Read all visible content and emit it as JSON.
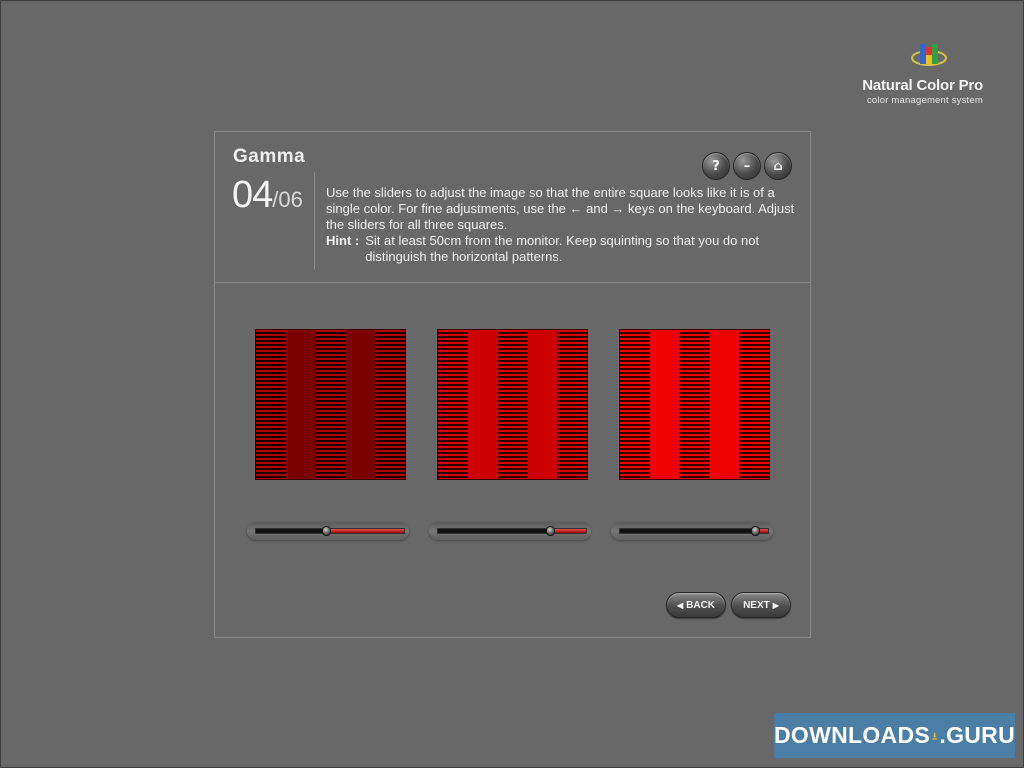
{
  "brand": {
    "name": "Natural Color Pro",
    "tagline": "color management system"
  },
  "header": {
    "title": "Gamma",
    "step_current": "04",
    "step_total": "/06",
    "description": "Use the sliders to adjust the image so that the entire square looks like it is of a single color.  For fine adjustments, use the ← and → keys on the keyboard.  Adjust the sliders for all three squares.",
    "hint_label": "Hint :",
    "hint_text": "Sit at least 50cm from the monitor.  Keep squinting so that you do not distinguish the horizontal patterns."
  },
  "toolbar": {
    "help_glyph": "?",
    "minimize_glyph": "–",
    "home_glyph": "⌂"
  },
  "squares": [
    {
      "stripe_color": "#7a0000",
      "line_color": "#b00000",
      "dark_color": "#1a0000"
    },
    {
      "stripe_color": "#cc0000",
      "line_color": "#d80000",
      "dark_color": "#2a0000"
    },
    {
      "stripe_color": "#ee0000",
      "line_color": "#f20000",
      "dark_color": "#330000"
    }
  ],
  "sliders": [
    {
      "value": 0.47
    },
    {
      "value": 0.76
    },
    {
      "value": 0.91
    }
  ],
  "nav": {
    "back_label": "BACK",
    "next_label": "NEXT"
  },
  "watermark": {
    "left": "DOWNLOADS",
    "right": ".GURU"
  }
}
